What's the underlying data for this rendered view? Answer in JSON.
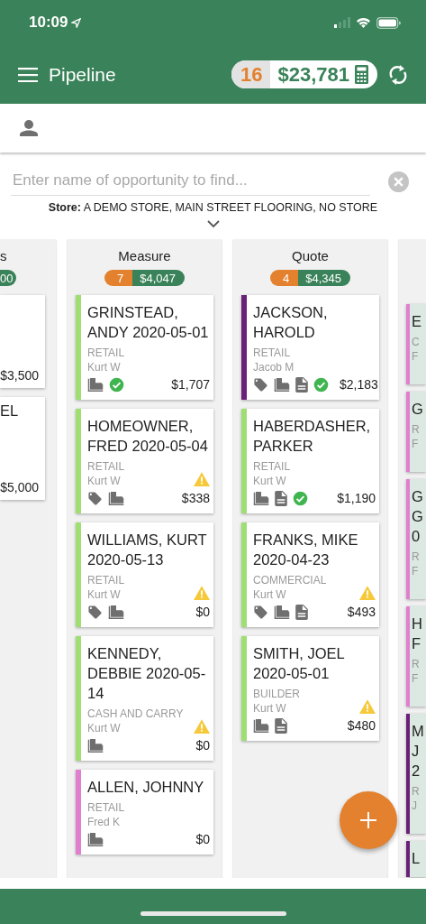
{
  "status_bar": {
    "time": "10:09"
  },
  "app_bar": {
    "title": "Pipeline",
    "count": "16",
    "total": "$23,781"
  },
  "search": {
    "placeholder": "Enter name of opportunity to find..."
  },
  "store_filter": {
    "text": "**Store:** A DEMO STORE, MAIN STREET FLOORING, NO STORE"
  },
  "columns": [
    {
      "kind": "partial-left",
      "title": "s",
      "total": "00",
      "cards": [
        {
          "amount": "$3,500"
        },
        {
          "lines": [
            "EL"
          ],
          "amount": "$5,000"
        }
      ]
    },
    {
      "kind": "full",
      "title": "Measure",
      "count": "7",
      "total": "$4,047",
      "cards": [
        {
          "name": "GRINSTEAD, ANDY 2020-05-01",
          "type": "RETAIL",
          "rep": "Kurt W",
          "color": "#9ede73",
          "tag": false,
          "samples": true,
          "document": false,
          "check": true,
          "warning": false,
          "amount": "$1,707"
        },
        {
          "name": "HOMEOWNER, FRED 2020-05-04",
          "type": "RETAIL",
          "rep": "Kurt W",
          "color": "#9ede73",
          "tag": true,
          "samples": true,
          "document": false,
          "check": false,
          "warning": true,
          "amount": "$338"
        },
        {
          "name": "WILLIAMS, KURT 2020-05-13",
          "type": "RETAIL",
          "rep": "Kurt W",
          "color": "#9ede73",
          "tag": true,
          "samples": true,
          "document": false,
          "check": false,
          "warning": true,
          "amount": "$0"
        },
        {
          "name": "KENNEDY, DEBBIE 2020-05-14",
          "type": "CASH AND CARRY",
          "rep": "Kurt W",
          "color": "#9ede73",
          "tag": false,
          "samples": true,
          "document": false,
          "check": false,
          "warning": true,
          "amount": "$0"
        },
        {
          "name": "ALLEN, JOHNNY",
          "type": "RETAIL",
          "rep": "Fred K",
          "color": "#e17fcf",
          "tag": false,
          "samples": true,
          "document": false,
          "check": false,
          "warning": false,
          "amount": "$0"
        }
      ]
    },
    {
      "kind": "full",
      "title": "Quote",
      "count": "4",
      "total": "$4,345",
      "cards": [
        {
          "name": "JACKSON, HAROLD",
          "type": "RETAIL",
          "rep": "Jacob M",
          "color": "#6a1f78",
          "tag": true,
          "samples": true,
          "document": true,
          "check": true,
          "warning": false,
          "amount": "$2,183"
        },
        {
          "name": "HABERDASHER, PARKER",
          "type": "RETAIL",
          "rep": "Kurt W",
          "color": "#9ede73",
          "tag": false,
          "samples": true,
          "document": true,
          "check": true,
          "warning": false,
          "amount": "$1,190"
        },
        {
          "name": "FRANKS, MIKE 2020-04-23",
          "type": "COMMERCIAL",
          "rep": "Kurt W",
          "color": "#9ede73",
          "tag": true,
          "samples": true,
          "document": true,
          "check": false,
          "warning": true,
          "amount": "$493"
        },
        {
          "name": "SMITH, JOEL 2020-05-01",
          "type": "BUILDER",
          "rep": "Kurt W",
          "color": "#9ede73",
          "tag": false,
          "samples": true,
          "document": true,
          "check": false,
          "warning": true,
          "amount": "$480"
        }
      ]
    },
    {
      "kind": "partial-right",
      "cards": [
        {
          "title_lines": [
            "E"
          ],
          "sub_lines": [
            "C",
            "F"
          ],
          "color": "#e17fcf"
        },
        {
          "title_lines": [
            "G"
          ],
          "sub_lines": [
            "R",
            "F"
          ],
          "color": "#e17fcf"
        },
        {
          "title_lines": [
            "G",
            "G",
            "0"
          ],
          "sub_lines": [
            "R",
            "F"
          ],
          "color": "#e17fcf"
        },
        {
          "title_lines": [
            "H",
            "F"
          ],
          "sub_lines": [
            "R",
            "F"
          ],
          "color": "#e17fcf"
        },
        {
          "title_lines": [
            "M",
            "J",
            "2"
          ],
          "sub_lines": [
            "R",
            "J"
          ],
          "color": "#6a1f78"
        },
        {
          "title_lines": [
            "L"
          ],
          "color": "#6a1f78"
        }
      ]
    }
  ]
}
